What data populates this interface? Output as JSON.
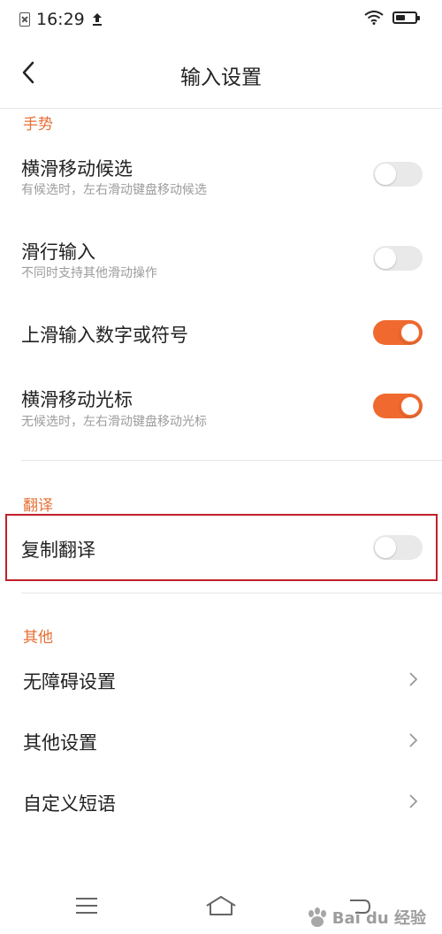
{
  "status_bar": {
    "time": "16:29"
  },
  "header": {
    "title": "输入设置"
  },
  "sections": {
    "gesture": {
      "title": "手势",
      "items": [
        {
          "title": "横滑移动候选",
          "subtitle": "有候选时，左右滑动键盘移动候选",
          "enabled": false
        },
        {
          "title": "滑行输入",
          "subtitle": "不同时支持其他滑动操作",
          "enabled": false
        },
        {
          "title": "上滑输入数字或符号",
          "enabled": true
        },
        {
          "title": "横滑移动光标",
          "subtitle": "无候选时，左右滑动键盘移动光标",
          "enabled": true
        }
      ]
    },
    "translate": {
      "title": "翻译",
      "items": [
        {
          "title": "复制翻译",
          "enabled": false
        }
      ]
    },
    "other": {
      "title": "其他",
      "items": [
        {
          "title": "无障碍设置"
        },
        {
          "title": "其他设置"
        },
        {
          "title": "自定义短语"
        }
      ]
    }
  },
  "watermark": {
    "text": "Bai du 经验"
  },
  "colors": {
    "accent": "#f06a30",
    "section_title": "#e76f34",
    "highlight": "#c0202a"
  },
  "icons": {
    "back": "chevron-left-icon",
    "wifi": "wifi-icon",
    "battery": "battery-icon",
    "menu": "menu-icon",
    "home": "home-icon",
    "chevron": "chevron-right-icon"
  }
}
